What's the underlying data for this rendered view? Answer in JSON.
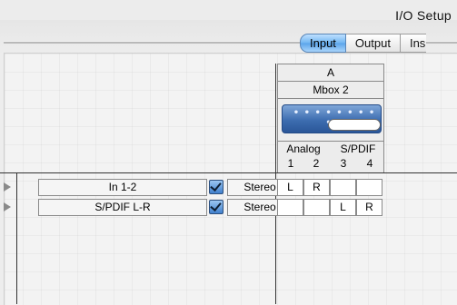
{
  "window": {
    "title": "I/O Setup"
  },
  "tabs": [
    {
      "label": "Input",
      "active": true
    },
    {
      "label": "Output",
      "active": false
    },
    {
      "label": "Ins",
      "active": false
    }
  ],
  "device": {
    "letter": "A",
    "name": "Mbox 2",
    "groups": [
      {
        "label": "Analog",
        "channels": [
          "1",
          "2"
        ]
      },
      {
        "label": "S/PDIF",
        "channels": [
          "3",
          "4"
        ]
      }
    ]
  },
  "rows": [
    {
      "name": "In 1-2",
      "checked": true,
      "format": "Stereo",
      "cells": [
        "L",
        "R",
        "",
        ""
      ]
    },
    {
      "name": "S/PDIF L-R",
      "checked": true,
      "format": "Stereo",
      "cells": [
        "",
        "",
        "L",
        "R"
      ]
    }
  ],
  "colors": {
    "accent": "#5aa4ea",
    "checkbox": "#3f7fcc"
  }
}
